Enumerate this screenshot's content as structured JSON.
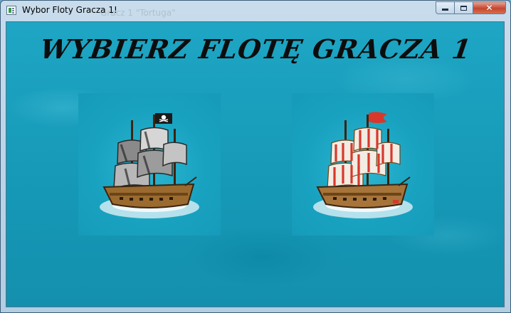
{
  "window": {
    "title": "Wybor Floty Gracza 1!",
    "ghost_title": "Gracz 1 \"Tortuga\"",
    "controls": {
      "minimize": "",
      "maximize": "",
      "close": "✕"
    }
  },
  "main": {
    "heading": "WYBIERZ FLOTĘ GRACZA 1"
  },
  "ships": [
    {
      "name": "pirate-ship",
      "flag_color": "#1b1b1b",
      "sail_color": "#9a9a9a"
    },
    {
      "name": "merchant-ship",
      "flag_color": "#d8382c",
      "sail_color": "#f2ece2"
    }
  ],
  "colors": {
    "ocean": "#1598b6",
    "heading": "#0d0d0d"
  }
}
